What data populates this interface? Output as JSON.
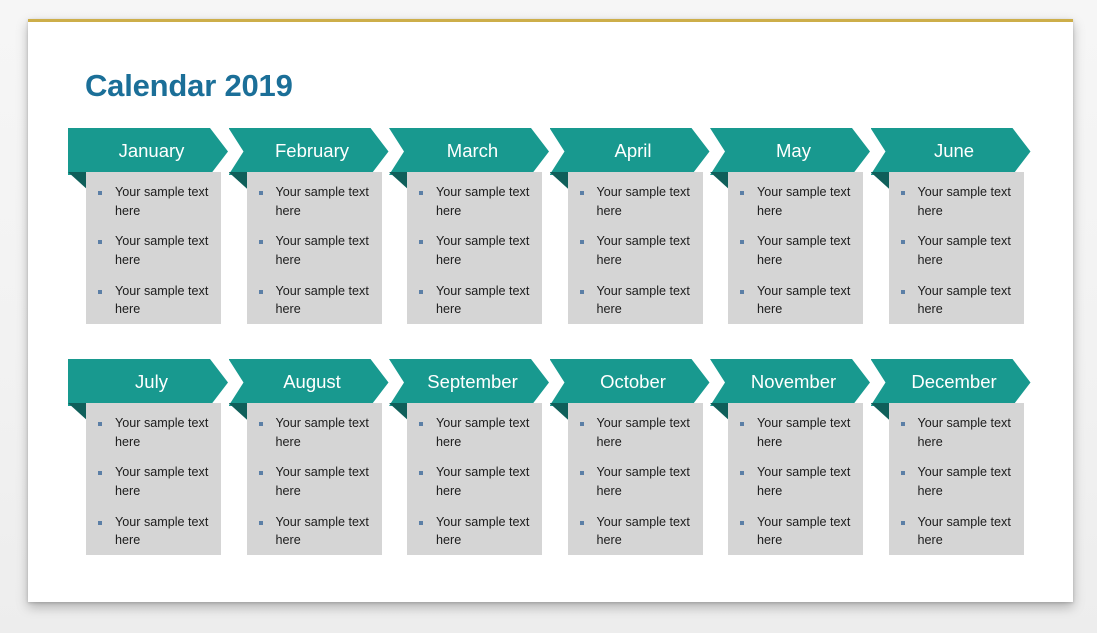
{
  "slide": {
    "title": "Calendar 2019",
    "accent_teal": "#18998f",
    "accent_teal_dark": "#0f5f5a",
    "title_color": "#1b6f98",
    "body_color": "#d5d5d5",
    "top_rule_color": "#cdae4a",
    "bullet_color": "#5b7fa6"
  },
  "rows": [
    {
      "months": [
        {
          "name": "January",
          "bullets": [
            "Your sample text here",
            "Your sample text here",
            "Your sample text here"
          ]
        },
        {
          "name": "February",
          "bullets": [
            "Your sample text here",
            "Your sample text here",
            "Your sample text here"
          ]
        },
        {
          "name": "March",
          "bullets": [
            "Your sample text here",
            "Your sample text here",
            "Your sample text here"
          ]
        },
        {
          "name": "April",
          "bullets": [
            "Your sample text here",
            "Your sample text here",
            "Your sample text here"
          ]
        },
        {
          "name": "May",
          "bullets": [
            "Your sample text here",
            "Your sample text here",
            "Your sample text here"
          ]
        },
        {
          "name": "June",
          "bullets": [
            "Your sample text here",
            "Your sample text here",
            "Your sample text here"
          ]
        }
      ]
    },
    {
      "months": [
        {
          "name": "July",
          "bullets": [
            "Your sample text here",
            "Your sample text here",
            "Your sample text here"
          ]
        },
        {
          "name": "August",
          "bullets": [
            "Your sample text here",
            "Your sample text here",
            "Your sample text here"
          ]
        },
        {
          "name": "September",
          "bullets": [
            "Your sample text here",
            "Your sample text here",
            "Your sample text here"
          ]
        },
        {
          "name": "October",
          "bullets": [
            "Your sample text here",
            "Your sample text here",
            "Your sample text here"
          ]
        },
        {
          "name": "November",
          "bullets": [
            "Your sample text here",
            "Your sample text here",
            "Your sample text here"
          ]
        },
        {
          "name": "December",
          "bullets": [
            "Your sample text here",
            "Your sample text here",
            "Your sample text here"
          ]
        }
      ]
    }
  ]
}
